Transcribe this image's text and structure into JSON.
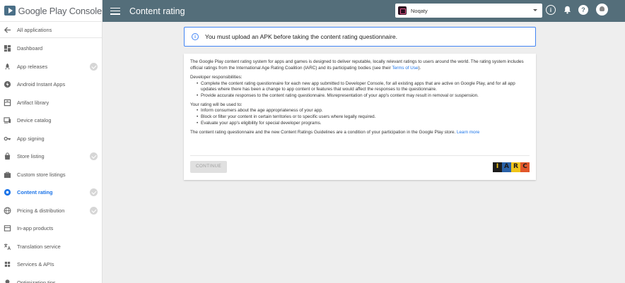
{
  "brand": {
    "name": "Google Play Console"
  },
  "topbar": {
    "title": "Content rating",
    "app_name": "Noqaty",
    "info_glyph": "i",
    "help_glyph": "?"
  },
  "sidebar": {
    "items": [
      {
        "label": "All applications",
        "icon": "arrow-back-icon",
        "checked": false
      },
      {
        "label": "Dashboard",
        "icon": "dashboard-icon",
        "checked": false
      },
      {
        "label": "App releases",
        "icon": "rocket-icon",
        "checked": true
      },
      {
        "label": "Android Instant Apps",
        "icon": "instant-apps-icon",
        "checked": false
      },
      {
        "label": "Artifact library",
        "icon": "archive-icon",
        "checked": false
      },
      {
        "label": "Device catalog",
        "icon": "device-icon",
        "checked": false
      },
      {
        "label": "App signing",
        "icon": "key-icon",
        "checked": false
      },
      {
        "label": "Store listing",
        "icon": "store-icon",
        "checked": true
      },
      {
        "label": "Custom store listings",
        "icon": "custom-store-icon",
        "checked": false
      },
      {
        "label": "Content rating",
        "icon": "rating-icon",
        "checked": true,
        "active": true
      },
      {
        "label": "Pricing & distribution",
        "icon": "globe-icon",
        "checked": true
      },
      {
        "label": "In-app products",
        "icon": "cart-icon",
        "checked": false
      },
      {
        "label": "Translation service",
        "icon": "translate-icon",
        "checked": false
      },
      {
        "label": "Services & APIs",
        "icon": "services-icon",
        "checked": false
      },
      {
        "label": "Optimization tips",
        "icon": "lightbulb-icon",
        "checked": false
      }
    ]
  },
  "notice": {
    "glyph": "i",
    "text": "You must upload an APK before taking the content rating questionnaire."
  },
  "card": {
    "intro": "The Google Play content rating system for apps and games is designed to deliver reputable, locally relevant ratings to users around the world. The rating system includes official ratings from the International Age Rating Coalition (IARC) and its participating bodies (see their ",
    "terms_link": "Terms of Use",
    "intro_end": ").",
    "responsibilities_heading": "Developer responsibilities:",
    "responsibilities": [
      "Complete the content rating questionnaire for each new app submitted to Developer Console, for all existing apps that are active on Google Play, and for all app updates where there has been a change to app content or features that would affect the responses to the questionnaire.",
      "Provide accurate responses to the content rating questionnaire. Misrepresentation of your app's content may result in removal or suspension."
    ],
    "uses_heading": "Your rating will be used to:",
    "uses": [
      "Inform consumers about the age appropriateness of your app.",
      "Block or filter your content in certain territories or to specific users where legally required.",
      "Evaluate your app's eligibility for special developer programs."
    ],
    "condition": "The content rating questionnaire and the new Content Ratings Guidelines are a condition of your participation in the Google Play store. ",
    "learn_more": "Learn more",
    "continue_label": "CONTINUE",
    "iarc_letters": [
      "I",
      "A",
      "R",
      "C"
    ]
  },
  "colors": {
    "topbar": "#546e7a",
    "accent": "#1a73e8",
    "notice_border": "#4285f4",
    "iarc_bg": [
      "#1c1c1c",
      "#2a62a8",
      "#f0c419",
      "#e2572b"
    ],
    "iarc_fg": [
      "#f0c419",
      "#1c1c1c",
      "#1c1c1c",
      "#1c1c1c"
    ]
  }
}
